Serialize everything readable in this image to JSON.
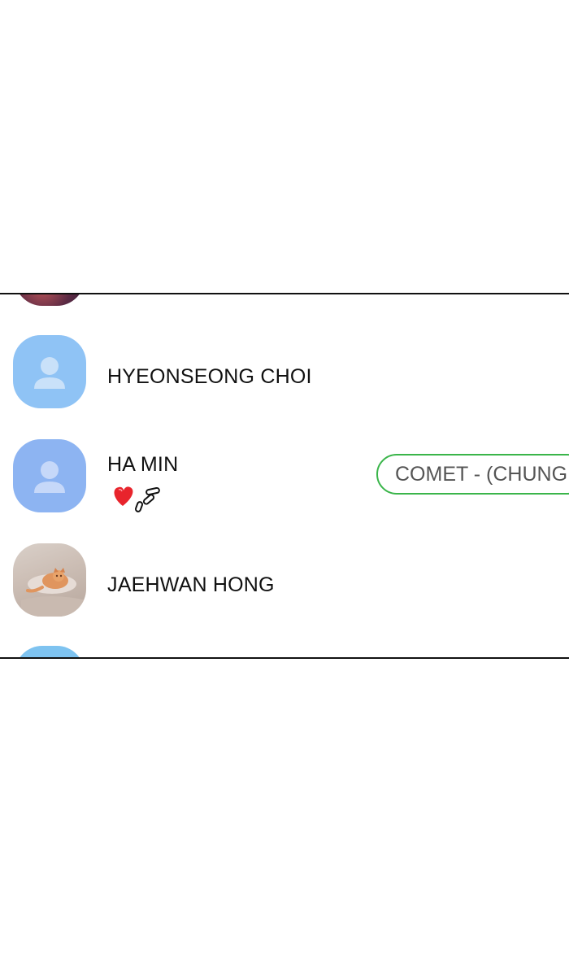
{
  "contacts": [
    {
      "name": "HYEONSEONG CHOI",
      "avatar_icon": "person-icon",
      "avatar_color": "#8fc3f5"
    },
    {
      "name": "HA MIN",
      "avatar_icon": "person-icon",
      "avatar_color": "#8db4f2",
      "emoji": "red-heart-sparkle",
      "status": "COMET - (CHUNG"
    },
    {
      "name": "JAEHWAN HONG",
      "avatar_icon": "photo-avatar"
    }
  ],
  "colors": {
    "status_border": "#3ab54a",
    "heart": "#e8242c"
  }
}
